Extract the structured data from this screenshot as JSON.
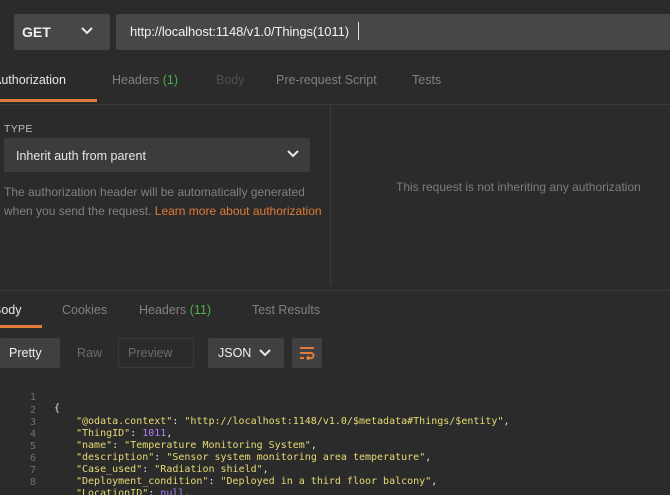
{
  "request": {
    "method": "GET",
    "url": "http://localhost:1148/v1.0/Things(1011)"
  },
  "request_tabs": {
    "authorization": "Authorization",
    "headers": "Headers",
    "headers_count": "(1)",
    "body": "Body",
    "prerequest": "Pre-request Script",
    "tests": "Tests"
  },
  "auth": {
    "type_label": "TYPE",
    "type_value": "Inherit auth from parent",
    "help_text": "The authorization header will be automatically generated when you send the request. ",
    "help_link": "Learn more about authorization",
    "note": "This request is not inheriting any authorization"
  },
  "response_tabs": {
    "body": "Body",
    "cookies": "Cookies",
    "headers": "Headers",
    "headers_count": "(11)",
    "test_results": "Test Results"
  },
  "view": {
    "pretty": "Pretty",
    "raw": "Raw",
    "preview": "Preview",
    "format": "JSON"
  },
  "code": {
    "lines": [
      {
        "n": "1",
        "open": "{"
      },
      {
        "n": "2",
        "key": "\"@odata.context\"",
        "val": "\"http://localhost:1148/v1.0/$metadata#Things/$entity\"",
        "kind": "str"
      },
      {
        "n": "3",
        "key": "\"ThingID\"",
        "val": "1011",
        "kind": "num"
      },
      {
        "n": "4",
        "key": "\"name\"",
        "val": "\"Temperature Monitoring System\"",
        "kind": "str"
      },
      {
        "n": "5",
        "key": "\"description\"",
        "val": "\"Sensor system monitoring area temperature\"",
        "kind": "str"
      },
      {
        "n": "6",
        "key": "\"Case_used\"",
        "val": "\"Radiation shield\"",
        "kind": "str"
      },
      {
        "n": "7",
        "key": "\"Deployment_condition\"",
        "val": "\"Deployed in a third floor balcony\"",
        "kind": "str"
      },
      {
        "n": "8",
        "key": "\"LocationID\"",
        "val": "null",
        "kind": "lit"
      }
    ]
  },
  "colors": {
    "accent": "#e07b39",
    "count_green": "#4cae4c"
  }
}
